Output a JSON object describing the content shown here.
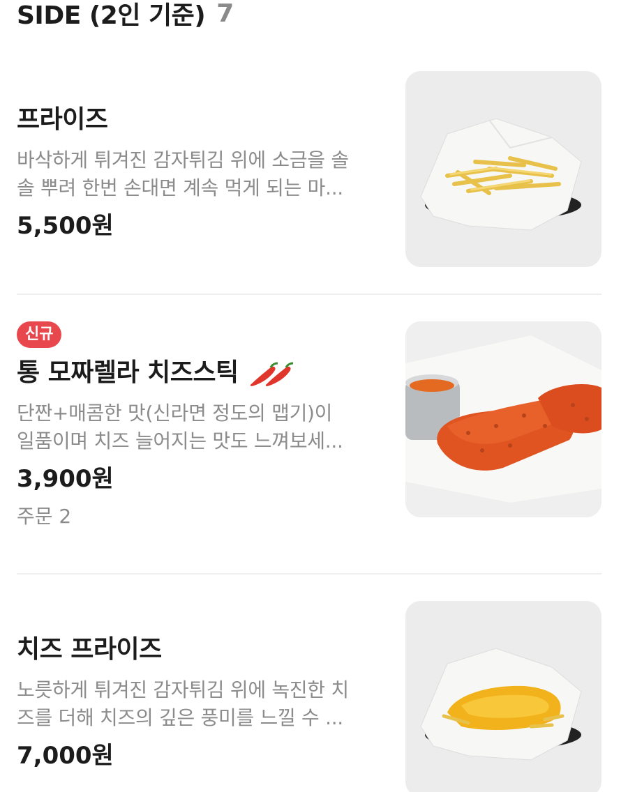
{
  "section": {
    "title": "SIDE (2인 기준)",
    "count": "7"
  },
  "items": [
    {
      "name": "프라이즈",
      "desc_line1": "바삭하게 튀겨진 감자튀김 위에 소금을 솔",
      "desc_line2": "솔 뿌려 한번 손대면 계속 먹게 되는 마...",
      "price": "5,500원",
      "image": "fries-basket-image"
    },
    {
      "badge": "신규",
      "name": "통 모짜렐라 치즈스틱",
      "spicy_icon": "chili-pepper-icon",
      "desc_line1": "단짠+매콤한 맛(신라면 정도의 맵기)이",
      "desc_line2": "일품이며 치즈 늘어지는 맛도 느껴보세...",
      "price": "3,900원",
      "orders": "주문 2",
      "image": "cheese-stick-image"
    },
    {
      "name": "치즈 프라이즈",
      "desc_line1": "노릇하게 튀겨진 감자튀김 위에 녹진한 치",
      "desc_line2": "즈를 더해 치즈의 깊은 풍미를 느낄 수 ...",
      "price": "7,000원",
      "image": "cheese-fries-image"
    }
  ],
  "colors": {
    "badge": "#e8474d",
    "muted": "#8b8b8b",
    "text": "#1c1c1c",
    "thumb_bg": "#ececec",
    "chili": "#e0352b"
  }
}
